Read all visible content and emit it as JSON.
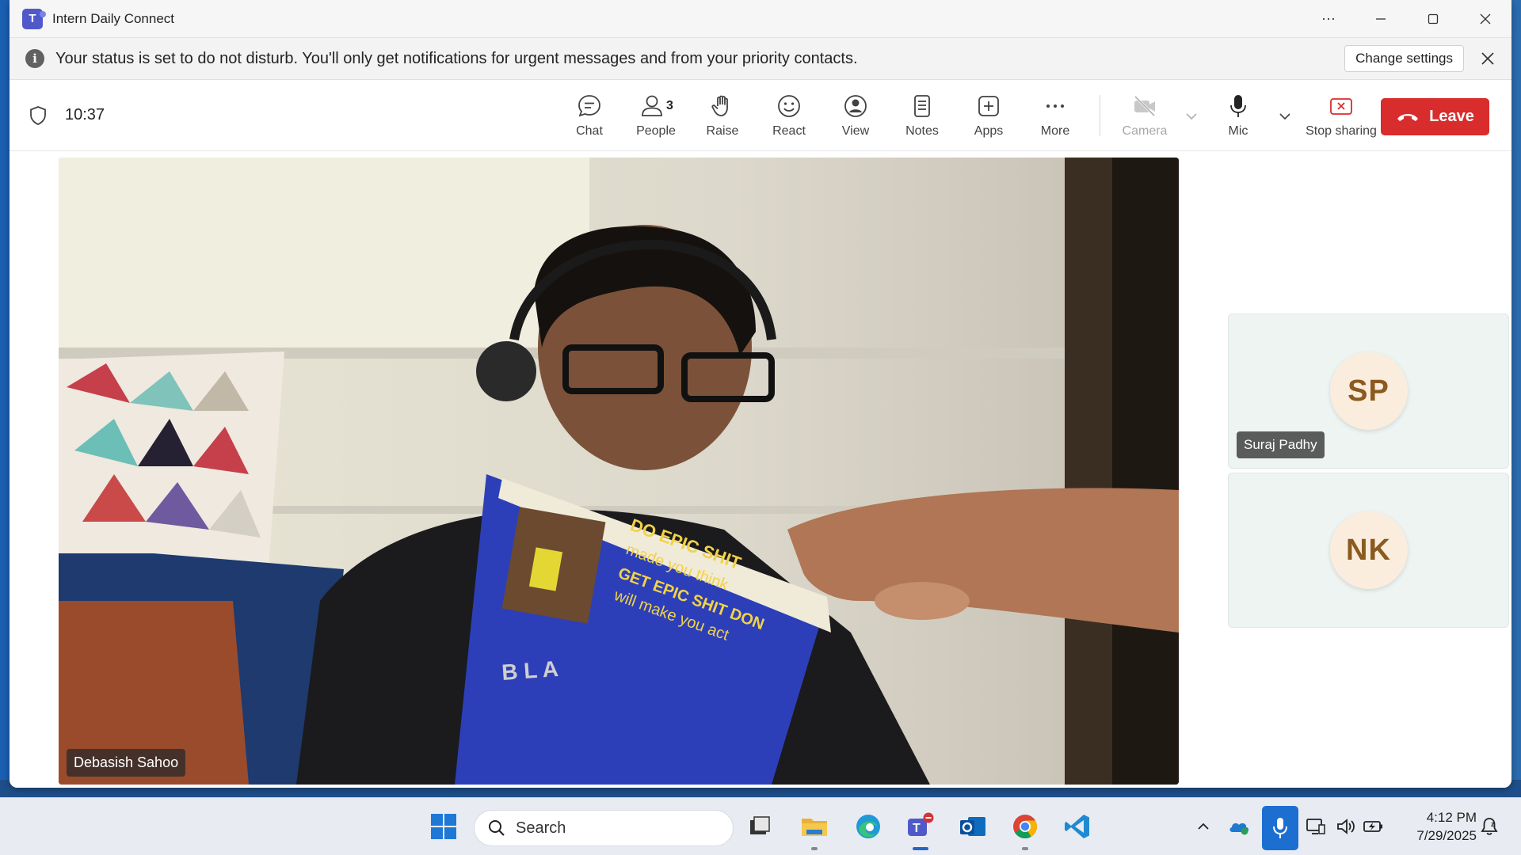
{
  "window": {
    "title": "Intern Daily Connect",
    "controls": {
      "more": "···",
      "minimize": "—",
      "maximize": "☐",
      "close": "✕"
    }
  },
  "banner": {
    "message": "Your status is set to do not disturb. You'll only get notifications for urgent messages and from your priority contacts.",
    "action_label": "Change settings"
  },
  "toolbar": {
    "timer": "10:37",
    "items": [
      {
        "label": "Chat",
        "icon": "chat-icon"
      },
      {
        "label": "People",
        "icon": "people-icon",
        "badge": "3"
      },
      {
        "label": "Raise",
        "icon": "hand-icon"
      },
      {
        "label": "React",
        "icon": "smile-icon"
      },
      {
        "label": "View",
        "icon": "view-icon"
      },
      {
        "label": "Notes",
        "icon": "notes-icon"
      },
      {
        "label": "Apps",
        "icon": "plus-icon"
      },
      {
        "label": "More",
        "icon": "more-icon"
      },
      {
        "label": "Camera",
        "icon": "camera-off-icon",
        "disabled": true
      },
      {
        "label": "Mic",
        "icon": "mic-icon"
      },
      {
        "label": "Stop sharing",
        "icon": "stop-share-icon"
      }
    ],
    "leave_label": "Leave",
    "colors": {
      "leave": "#d92c2c",
      "stop_share": "#d92c2c"
    }
  },
  "stage": {
    "main_participant": "Debasish Sahoo",
    "participants": [
      {
        "initials": "SP",
        "name": "Suraj Padhy"
      },
      {
        "initials": "NK",
        "name": ""
      }
    ]
  },
  "taskbar": {
    "search_placeholder": "Search",
    "apps": [
      "windows-start-icon",
      "task-view-icon",
      "file-explorer-icon",
      "edge-icon",
      "teams-icon",
      "outlook-icon",
      "chrome-icon",
      "vscode-icon"
    ],
    "time": "4:12 PM",
    "date": "7/29/2025"
  }
}
